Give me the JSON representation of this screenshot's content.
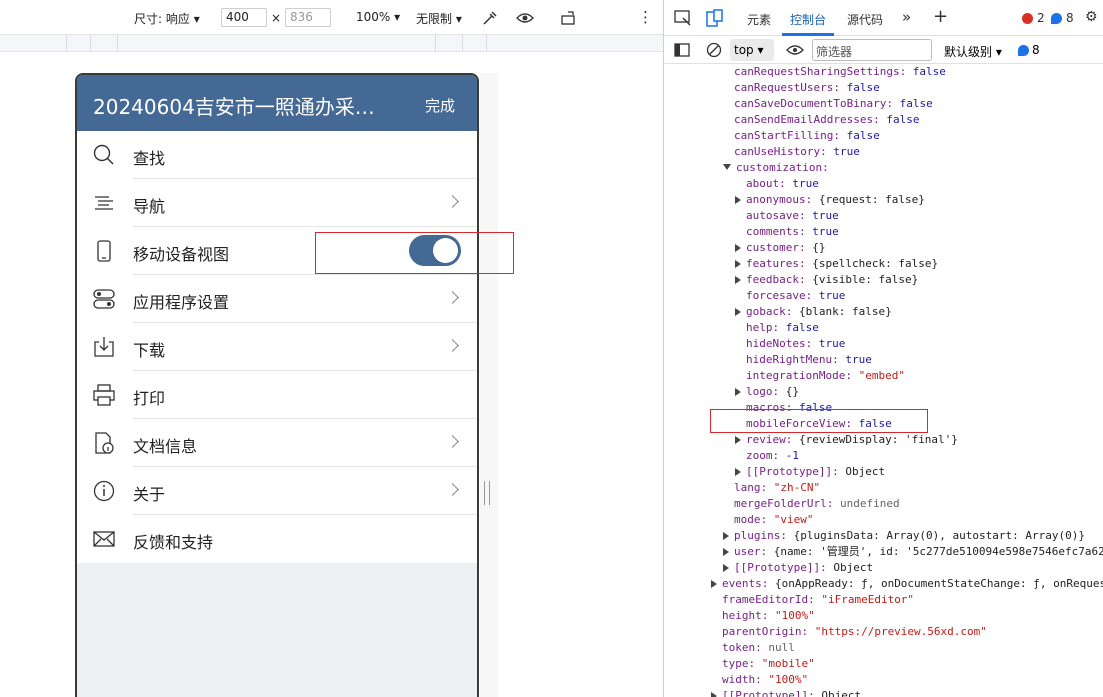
{
  "device_toolbar": {
    "size_label": "尺寸: 响应",
    "width": "400",
    "times": "×",
    "height": "836",
    "zoom": "100%",
    "throttle": "无限制"
  },
  "phone": {
    "title": "20240604吉安市一照通办采…",
    "done": "完成",
    "menu": [
      {
        "label": "查找",
        "icon": "search-icon"
      },
      {
        "label": "导航",
        "icon": "navigation-icon"
      },
      {
        "label": "移动设备视图",
        "icon": "mobile-icon"
      },
      {
        "label": "应用程序设置",
        "icon": "settings-toggle-icon"
      },
      {
        "label": "下载",
        "icon": "download-icon"
      },
      {
        "label": "打印",
        "icon": "printer-icon"
      },
      {
        "label": "文档信息",
        "icon": "document-info-icon"
      },
      {
        "label": "关于",
        "icon": "info-icon"
      },
      {
        "label": "反馈和支持",
        "icon": "mail-icon"
      }
    ]
  },
  "devtools": {
    "tabs": [
      "元素",
      "控制台",
      "源代码"
    ],
    "errors": "2",
    "messages": "8",
    "context": "top",
    "filter_placeholder": "筛选器",
    "level": "默认级别",
    "msg_count": "8"
  },
  "console_lines": [
    {
      "t": "kv",
      "i": 1,
      "k": "canRequestSharingSettings",
      "v": "false",
      "c": "v"
    },
    {
      "t": "kv",
      "i": 1,
      "k": "canRequestUsers",
      "v": "false",
      "c": "v"
    },
    {
      "t": "kv",
      "i": 1,
      "k": "canSaveDocumentToBinary",
      "v": "false",
      "c": "v"
    },
    {
      "t": "kv",
      "i": 1,
      "k": "canSendEmailAddresses",
      "v": "false",
      "c": "v"
    },
    {
      "t": "kv",
      "i": 1,
      "k": "canStartFilling",
      "v": "false",
      "c": "v"
    },
    {
      "t": "kv",
      "i": 1,
      "k": "canUseHistory",
      "v": "true",
      "c": "v"
    },
    {
      "t": "open",
      "i": 1,
      "k": "customization",
      "v": ""
    },
    {
      "t": "kv",
      "i": 2,
      "k": "about",
      "v": "true",
      "c": "v"
    },
    {
      "t": "obj",
      "i": 2,
      "k": "anonymous",
      "v": "{request: false}"
    },
    {
      "t": "kv",
      "i": 2,
      "k": "autosave",
      "v": "true",
      "c": "v"
    },
    {
      "t": "kv",
      "i": 2,
      "k": "comments",
      "v": "true",
      "c": "v"
    },
    {
      "t": "obj",
      "i": 2,
      "k": "customer",
      "v": "{}"
    },
    {
      "t": "obj",
      "i": 2,
      "k": "features",
      "v": "{spellcheck: false}"
    },
    {
      "t": "obj",
      "i": 2,
      "k": "feedback",
      "v": "{visible: false}"
    },
    {
      "t": "kv",
      "i": 2,
      "k": "forcesave",
      "v": "true",
      "c": "v"
    },
    {
      "t": "obj",
      "i": 2,
      "k": "goback",
      "v": "{blank: false}"
    },
    {
      "t": "kv",
      "i": 2,
      "k": "help",
      "v": "false",
      "c": "v"
    },
    {
      "t": "kv",
      "i": 2,
      "k": "hideNotes",
      "v": "true",
      "c": "v"
    },
    {
      "t": "kv",
      "i": 2,
      "k": "hideRightMenu",
      "v": "true",
      "c": "v"
    },
    {
      "t": "kv",
      "i": 2,
      "k": "integrationMode",
      "v": "\"embed\"",
      "c": "s"
    },
    {
      "t": "obj",
      "i": 2,
      "k": "logo",
      "v": "{}"
    },
    {
      "t": "kv",
      "i": 2,
      "k": "macros",
      "v": "false",
      "c": "v"
    },
    {
      "t": "kv",
      "i": 2,
      "k": "mobileForceView",
      "v": "false",
      "c": "v"
    },
    {
      "t": "obj",
      "i": 2,
      "k": "review",
      "v": "{reviewDisplay: 'final'}"
    },
    {
      "t": "kv",
      "i": 2,
      "k": "zoom",
      "v": "-1",
      "c": "v"
    },
    {
      "t": "obj",
      "i": 2,
      "k": "[[Prototype]]",
      "v": "Object"
    },
    {
      "t": "kv",
      "i": 1,
      "k": "lang",
      "v": "\"zh-CN\"",
      "c": "s"
    },
    {
      "t": "kv",
      "i": 1,
      "k": "mergeFolderUrl",
      "v": "undefined",
      "c": "u"
    },
    {
      "t": "kv",
      "i": 1,
      "k": "mode",
      "v": "\"view\"",
      "c": "s"
    },
    {
      "t": "obj",
      "i": 1,
      "k": "plugins",
      "v": "{pluginsData: Array(0), autostart: Array(0)}"
    },
    {
      "t": "obj",
      "i": 1,
      "k": "user",
      "v": "{name: '管理员', id: '5c277de510094e598e7546efc7a62"
    },
    {
      "t": "obj",
      "i": 1,
      "k": "[[Prototype]]",
      "v": "Object"
    },
    {
      "t": "obj",
      "i": 0,
      "k": "events",
      "v": "{onAppReady: ƒ, onDocumentStateChange: ƒ, onRequest"
    },
    {
      "t": "kv",
      "i": 0,
      "k": "frameEditorId",
      "v": "\"iFrameEditor\"",
      "c": "s"
    },
    {
      "t": "kv",
      "i": 0,
      "k": "height",
      "v": "\"100%\"",
      "c": "s"
    },
    {
      "t": "kv",
      "i": 0,
      "k": "parentOrigin",
      "v": "\"https://preview.56xd.com\"",
      "c": "s"
    },
    {
      "t": "kv",
      "i": 0,
      "k": "token",
      "v": "null",
      "c": "u"
    },
    {
      "t": "kv",
      "i": 0,
      "k": "type",
      "v": "\"mobile\"",
      "c": "s"
    },
    {
      "t": "kv",
      "i": 0,
      "k": "width",
      "v": "\"100%\"",
      "c": "s"
    },
    {
      "t": "obj",
      "i": 0,
      "k": "[[Prototype]]",
      "v": "Object"
    }
  ]
}
